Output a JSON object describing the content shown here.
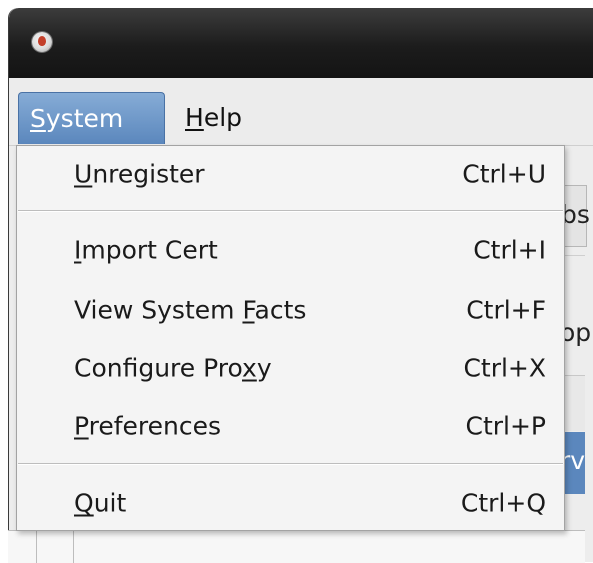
{
  "window": {
    "app_icon": "redhat-subscription-icon"
  },
  "menubar": {
    "system": {
      "pre": "",
      "mnemonic": "S",
      "post": "ystem"
    },
    "help": {
      "pre": "",
      "mnemonic": "H",
      "post": "elp"
    }
  },
  "background": {
    "frag1": "bs",
    "frag2": "op",
    "frag3": "rv"
  },
  "menu": {
    "items": [
      {
        "pre": "",
        "mnemonic": "U",
        "post": "nregister",
        "accel": "Ctrl+U"
      },
      {
        "pre": "",
        "mnemonic": "I",
        "post": "mport Cert",
        "accel": "Ctrl+I"
      },
      {
        "pre": "View System ",
        "mnemonic": "F",
        "post": "acts",
        "accel": "Ctrl+F"
      },
      {
        "pre": "Configure Pro",
        "mnemonic": "x",
        "post": "y",
        "accel": "Ctrl+X"
      },
      {
        "pre": "",
        "mnemonic": "P",
        "post": "references",
        "accel": "Ctrl+P"
      },
      {
        "pre": "",
        "mnemonic": "Q",
        "post": "uit",
        "accel": "Ctrl+Q"
      }
    ]
  }
}
